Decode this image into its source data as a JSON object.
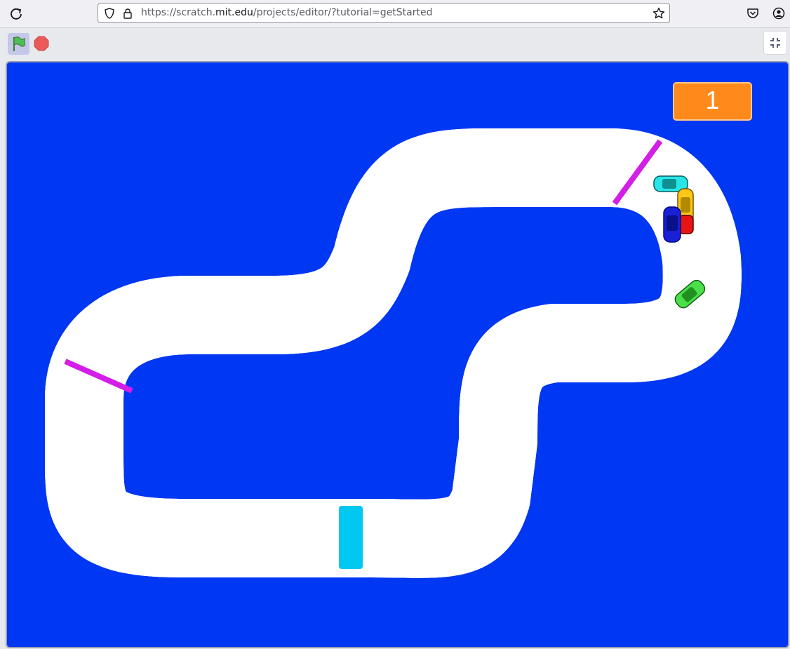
{
  "browser": {
    "url_prefix": "https://scratch.",
    "url_domain": "mit.edu",
    "url_path": "/projects/editor/?tutorial=getStarted"
  },
  "player": {
    "green_flag": "green-flag-icon",
    "stop": "stop-icon",
    "fullscreen": "exit-fullscreen-icon"
  },
  "stage": {
    "background_color": "#0037f3",
    "track_color": "#8f8f8f",
    "curb_colors": [
      "#e8541c",
      "#ffffff"
    ],
    "checkpoint_color": "#d21ee6",
    "finish_line_color": "#00c8f0",
    "counter_value": "1",
    "counter_color": "#ff8a1c",
    "cars": [
      "cyan-car",
      "yellow-car",
      "blue-car",
      "red-car",
      "green-car"
    ]
  }
}
